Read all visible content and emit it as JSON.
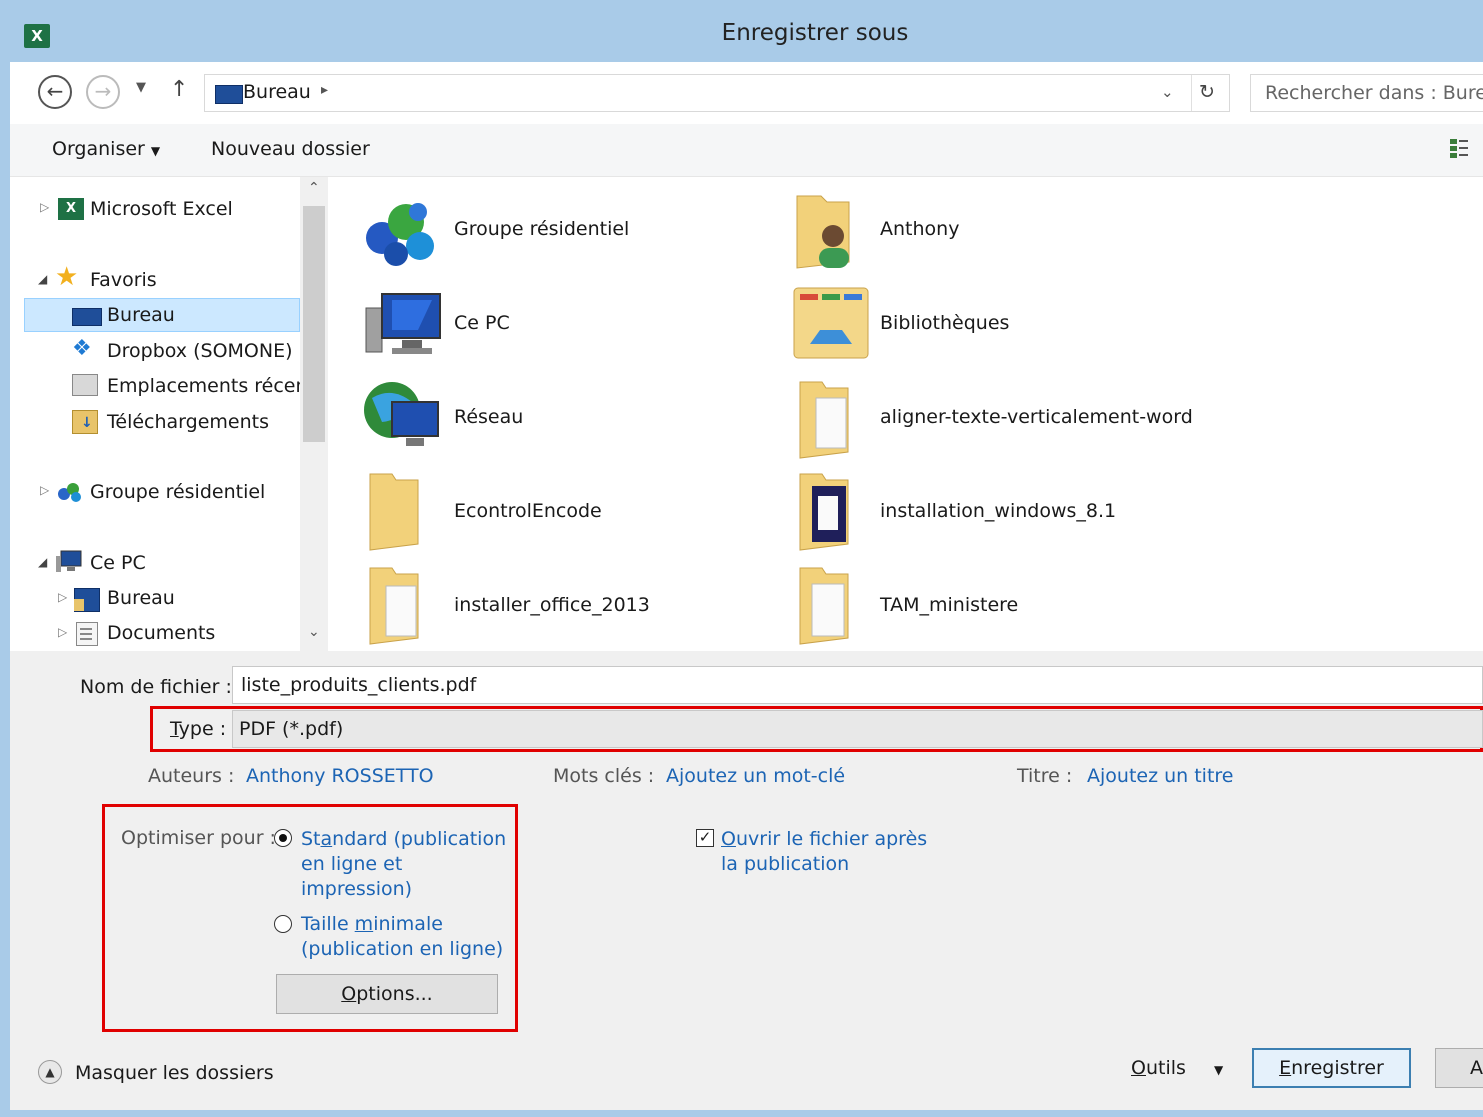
{
  "window": {
    "title": "Enregistrer sous",
    "app_icon": "excel-icon"
  },
  "address_bar": {
    "path": [
      "Bureau"
    ],
    "search_placeholder": "Rechercher dans : Bureau"
  },
  "toolbar": {
    "organize_label": "Organiser",
    "new_folder_label": "Nouveau dossier"
  },
  "nav_tree": {
    "items": [
      {
        "label": "Microsoft Excel",
        "icon": "excel-icon"
      },
      {
        "label": "Favoris",
        "icon": "star-icon"
      },
      {
        "label": "Bureau",
        "icon": "desktop-icon"
      },
      {
        "label": "Dropbox (SOMONE)",
        "icon": "dropbox-icon"
      },
      {
        "label": "Emplacements récent",
        "icon": "recent-places-icon"
      },
      {
        "label": "Téléchargements",
        "icon": "downloads-icon"
      },
      {
        "label": "Groupe résidentiel",
        "icon": "homegroup-icon"
      },
      {
        "label": "Ce PC",
        "icon": "computer-icon"
      },
      {
        "label": "Bureau",
        "icon": "desktop-folder-icon"
      },
      {
        "label": "Documents",
        "icon": "documents-icon"
      }
    ]
  },
  "files": {
    "items": [
      {
        "label": "Groupe résidentiel",
        "icon": "homegroup-icon"
      },
      {
        "label": "Anthony",
        "icon": "user-folder-icon"
      },
      {
        "label": "Ce PC",
        "icon": "computer-icon"
      },
      {
        "label": "Bibliothèques",
        "icon": "libraries-icon"
      },
      {
        "label": "Réseau",
        "icon": "network-icon"
      },
      {
        "label": "aligner-texte-verticalement-word",
        "icon": "folder-icon"
      },
      {
        "label": "EcontrolEncode",
        "icon": "folder-icon"
      },
      {
        "label": "installation_windows_8.1",
        "icon": "folder-icon"
      },
      {
        "label": "installer_office_2013",
        "icon": "folder-icon"
      },
      {
        "label": "TAM_ministere",
        "icon": "folder-icon"
      }
    ]
  },
  "form": {
    "filename_label": "Nom de fichier :",
    "filename_value": "liste_produits_clients.pdf",
    "type_label_pre": "T",
    "type_label_post": "ype :",
    "type_value": "PDF (*.pdf)",
    "authors_label": "Auteurs :",
    "authors_value": "Anthony ROSSETTO",
    "keywords_label": "Mots clés :",
    "keywords_value": "Ajoutez un mot-clé",
    "title_label": "Titre :",
    "title_value": "Ajoutez un titre"
  },
  "optimize": {
    "label": "Optimiser pour :",
    "standard_line1_pre": "St",
    "standard_line1_u": "a",
    "standard_line1_post": "ndard (publication",
    "standard_line2": "en ligne et",
    "standard_line3": "impression)",
    "minimal_line1_pre": "Taille ",
    "minimal_line1_u": "m",
    "minimal_line1_post": "inimale",
    "minimal_line2": "(publication en ligne)",
    "options_pre": "",
    "options_u": "O",
    "options_post": "ptions..."
  },
  "open_after": {
    "line1_u": "O",
    "line1_post": "uvrir le fichier après",
    "line2": "la publication",
    "checked": true
  },
  "footer": {
    "hide_folders": "Masquer les dossiers",
    "tools_u": "O",
    "tools_post": "utils",
    "save_u": "E",
    "save_post": "nregistrer",
    "cancel_partial": "A"
  }
}
